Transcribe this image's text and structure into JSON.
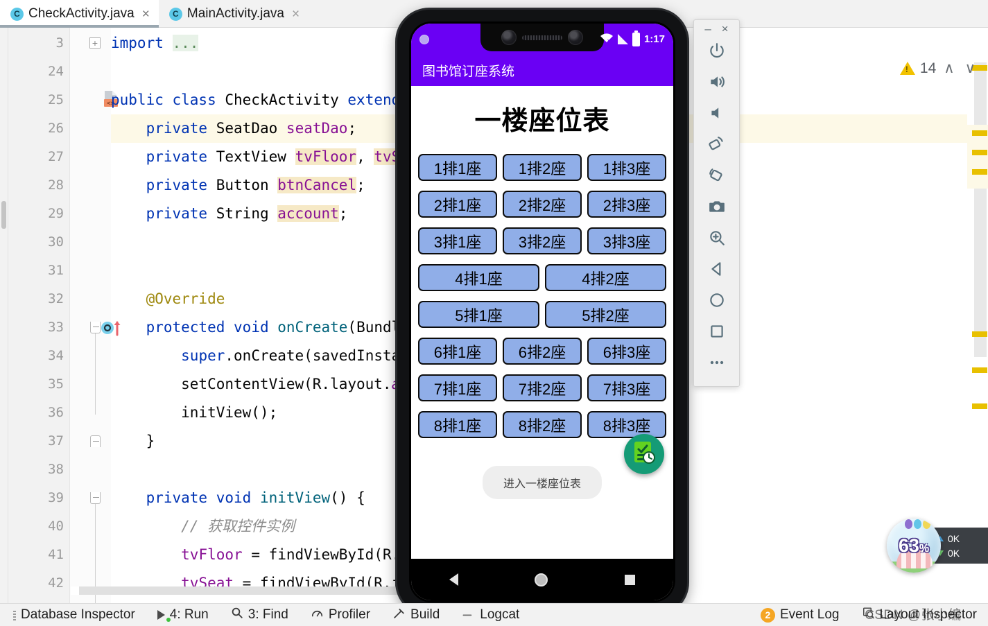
{
  "ide": {
    "tabs": [
      {
        "label": "CheckActivity.java",
        "icon": "java-class-icon",
        "badge": "C",
        "active": true,
        "close": "×"
      },
      {
        "label": "MainActivity.java",
        "icon": "java-class-icon",
        "badge": "C",
        "active": false,
        "close": "×"
      }
    ],
    "inspection": {
      "count": "14",
      "up": "∧",
      "down": "∨"
    },
    "status_items": [
      {
        "name": "database-inspector",
        "label": "Database Inspector",
        "icon": "grip-icon"
      },
      {
        "name": "run",
        "label": "4: Run",
        "prefix": "4",
        "icon": "run-icon"
      },
      {
        "name": "find",
        "label": "3: Find",
        "prefix": "3",
        "icon": "search-icon"
      },
      {
        "name": "profiler",
        "label": "Profiler",
        "icon": "profiler-icon"
      },
      {
        "name": "build",
        "label": "Build",
        "icon": "hammer-icon"
      },
      {
        "name": "logcat",
        "label": "Logcat",
        "icon": "logcat-icon"
      },
      {
        "name": "event-log",
        "label": "Event Log",
        "icon": "event-log-icon",
        "badge": "2"
      },
      {
        "name": "layout-inspector",
        "label": "Layout Inspector",
        "icon": "layout-inspector-icon"
      }
    ],
    "watermark": "CSDN @张小编"
  },
  "code": {
    "lines": [
      {
        "num": "3",
        "html": "<span class='kw'>import</span> <span class='fold-ellipsis'>...</span>",
        "gutter": "fold-plus"
      },
      {
        "num": "24",
        "html": ""
      },
      {
        "num": "25",
        "html": "<span class='kw'>public class</span> <span class='type'>CheckActivity</span> <span class='kw'>extends</span>",
        "gutter": "xml-layout-icon"
      },
      {
        "num": "26",
        "html": "    <span class='kw'>private</span> <span class='type'>SeatDao</span> <span class='fld'>seatDao</span>;",
        "highlight": "caret"
      },
      {
        "num": "27",
        "html": "    <span class='kw'>private</span> <span class='type'>TextView</span> <span class='fld hlfield'>tvFloor</span>, <span class='fld hlfield'>tvSe</span>"
      },
      {
        "num": "28",
        "html": "    <span class='kw'>private</span> <span class='type'>Button</span> <span class='fld hlfield'>btnCancel</span>;"
      },
      {
        "num": "29",
        "html": "    <span class='kw'>private</span> <span class='type'>String</span> <span class='fld hlfield'>account</span>;"
      },
      {
        "num": "30",
        "html": ""
      },
      {
        "num": "31",
        "html": ""
      },
      {
        "num": "32",
        "html": "    <span class='ann'>@Override</span>"
      },
      {
        "num": "33",
        "html": "    <span class='kw'>protected</span> <span class='kw'>void</span> <span class='mth'>onCreate</span>(<span class='type'>Bundle</span>",
        "gutter": "override-icon"
      },
      {
        "num": "34",
        "html": "        <span class='kw'>super</span>.<span class='type'>onCreate</span>(savedInstan"
      },
      {
        "num": "35",
        "html": "        setContentView(R.layout.<span class='stat'>a</span>"
      },
      {
        "num": "36",
        "html": "        initView();"
      },
      {
        "num": "37",
        "html": "    }"
      },
      {
        "num": "38",
        "html": ""
      },
      {
        "num": "39",
        "html": "    <span class='kw'>private</span> <span class='kw'>void</span> <span class='mth'>initView</span>() {"
      },
      {
        "num": "40",
        "html": "        <span class='cmt'>// 获取控件实例</span>"
      },
      {
        "num": "41",
        "html": "        <span class='fld'>tvFloor</span> = findViewById(R."
      },
      {
        "num": "42",
        "html": "        <span class='fld'>tvSeat</span> = findViewById(R.id"
      }
    ]
  },
  "emulator": {
    "brand_color": "#6a00f4",
    "window_buttons": [
      {
        "name": "minimize",
        "glyph": "–"
      },
      {
        "name": "close",
        "glyph": "×"
      }
    ],
    "toolbar_buttons": [
      {
        "name": "power-icon",
        "label": "Power"
      },
      {
        "name": "volume-up-icon",
        "label": "Volume Up"
      },
      {
        "name": "volume-down-icon",
        "label": "Volume Down"
      },
      {
        "name": "rotate-left-icon",
        "label": "Rotate Left"
      },
      {
        "name": "rotate-right-icon",
        "label": "Rotate Right"
      },
      {
        "name": "camera-icon",
        "label": "Take Screenshot"
      },
      {
        "name": "zoom-icon",
        "label": "Zoom Mode"
      },
      {
        "name": "back-icon",
        "label": "Back"
      },
      {
        "name": "home-icon",
        "label": "Home"
      },
      {
        "name": "overview-icon",
        "label": "Overview"
      },
      {
        "name": "more-icon",
        "label": "More"
      }
    ],
    "status": {
      "time": "1:17",
      "wifi_icon": "wifi-off-icon",
      "cell_icon": "cellular-signal-icon",
      "battery_icon": "battery-icon"
    },
    "nav": [
      {
        "name": "nav-back-icon"
      },
      {
        "name": "nav-home-icon"
      },
      {
        "name": "nav-recents-icon"
      }
    ]
  },
  "app": {
    "appbar_title": "图书馆订座系统",
    "page_title": "一楼座位表",
    "seat_rows": [
      {
        "seats": [
          "1排1座",
          "1排2座",
          "1排3座"
        ]
      },
      {
        "seats": [
          "2排1座",
          "2排2座",
          "2排3座"
        ]
      },
      {
        "seats": [
          "3排1座",
          "3排2座",
          "3排3座"
        ]
      },
      {
        "seats": [
          "4排1座",
          "4排2座"
        ]
      },
      {
        "seats": [
          "5排1座",
          "5排2座"
        ]
      },
      {
        "seats": [
          "6排1座",
          "6排2座",
          "6排3座"
        ]
      },
      {
        "seats": [
          "7排1座",
          "7排2座",
          "7排3座"
        ]
      },
      {
        "seats": [
          "8排1座",
          "8排2座",
          "8排3座"
        ]
      }
    ],
    "enter_button": "进入一楼座位表",
    "fab_icon": "checklist-clock-icon",
    "seat_color": "#90aee8"
  },
  "netwidget": {
    "percent": "63",
    "percent_suffix": "%",
    "upload": "0K",
    "download": "0K"
  }
}
